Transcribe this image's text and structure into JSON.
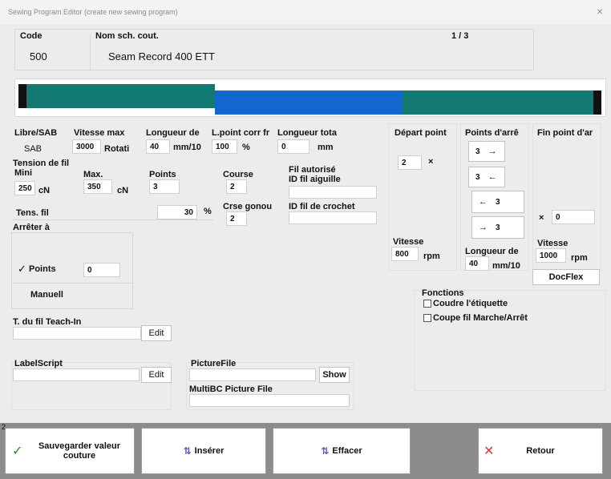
{
  "window": {
    "title": "Sewing Program Editor (create new sewing program)",
    "close_glyph": "×"
  },
  "header": {
    "code_label": "Code",
    "code_value": "500",
    "name_label": "Nom sch. cout.",
    "name_value": "Seam Record 400 ETT",
    "page": "1 / 3"
  },
  "bar": {
    "segments": [
      {
        "color": "#111111"
      },
      {
        "color": "#127a72"
      },
      {
        "color": "#1266cc"
      },
      {
        "color": "#127a72"
      },
      {
        "color": "#111111"
      }
    ]
  },
  "fields": {
    "libre_label": "Libre/SAB",
    "libre_value": "SAB",
    "vitesse_max_label": "Vitesse max",
    "vitesse_max_value": "3000",
    "vitesse_max_unit": "Rotati",
    "longueur_label": "Longueur de",
    "longueur_value": "40",
    "longueur_unit": "mm/10",
    "lpoint_label": "L.point corr fr",
    "lpoint_value": "100",
    "lpoint_unit": "%",
    "longueur_tot_label": "Longueur tota",
    "longueur_tot_value": "0",
    "longueur_tot_unit": "mm",
    "tension_label": "Tension de fil",
    "mini_label": "Mini",
    "mini_value": "250",
    "mini_unit": "cN",
    "max_label": "Max.",
    "max_value": "350",
    "max_unit": "cN",
    "points_label": "Points",
    "points_value": "3",
    "course_label": "Course",
    "course_value": "2",
    "crse_label": "Crse gonou",
    "crse_value": "2",
    "fil_autorise_label": "Fil autorisé",
    "id_aiguille_label": "ID fil aiguille",
    "id_aiguille_value": "",
    "id_crochet_label": "ID fil de crochet",
    "id_crochet_value": "",
    "tens_fil_label": "Tens. fil",
    "tens_fil_value": "30",
    "tens_fil_unit": "%"
  },
  "depart": {
    "label": "Départ point",
    "value": "2",
    "x_glyph": "×",
    "vitesse_label": "Vitesse",
    "vitesse_value": "800",
    "vitesse_unit": "rpm"
  },
  "points_arret": {
    "label": "Points d'arrê",
    "rows": [
      {
        "value": "3",
        "arrow": "→"
      },
      {
        "value": "3",
        "arrow": "←"
      },
      {
        "value": "3",
        "arrow": "←"
      },
      {
        "value": "3",
        "arrow": "→"
      }
    ],
    "longueur_label": "Longueur de",
    "longueur_value": "40",
    "longueur_unit": "mm/10"
  },
  "fin_point": {
    "label": "Fin point d'ar",
    "x_glyph": "×",
    "value": "0",
    "vitesse_label": "Vitesse",
    "vitesse_value": "1000",
    "vitesse_unit": "rpm",
    "docflex_label": "DocFlex"
  },
  "arreter": {
    "label": "Arrêter à",
    "points_check": "✓",
    "points_label": "Points",
    "points_value": "0",
    "manuel_label": "Manuell"
  },
  "teach": {
    "label": "T. du fil Teach-In",
    "value": "",
    "edit_label": "Edit"
  },
  "labelscript": {
    "label": "LabelScript",
    "value": "",
    "edit_label": "Edit"
  },
  "picture": {
    "label": "PictureFile",
    "value": "",
    "show_label": "Show",
    "multibc_label": "MultiBC Picture File",
    "multibc_value": ""
  },
  "fonctions": {
    "label": "Fonctions",
    "opt1": "Coudre l'étiquette",
    "opt2": "Coupe fil Marche/Arrêt"
  },
  "footer": {
    "marker": "2",
    "save_label": "Sauvegarder valeur couture",
    "insert_label": "Insérer",
    "delete_label": "Effacer",
    "retour_label": "Retour",
    "colors": {
      "check": "#2a8a2a",
      "retour_x": "#d23a2a",
      "insert_icon": "#6a4fbf"
    }
  }
}
